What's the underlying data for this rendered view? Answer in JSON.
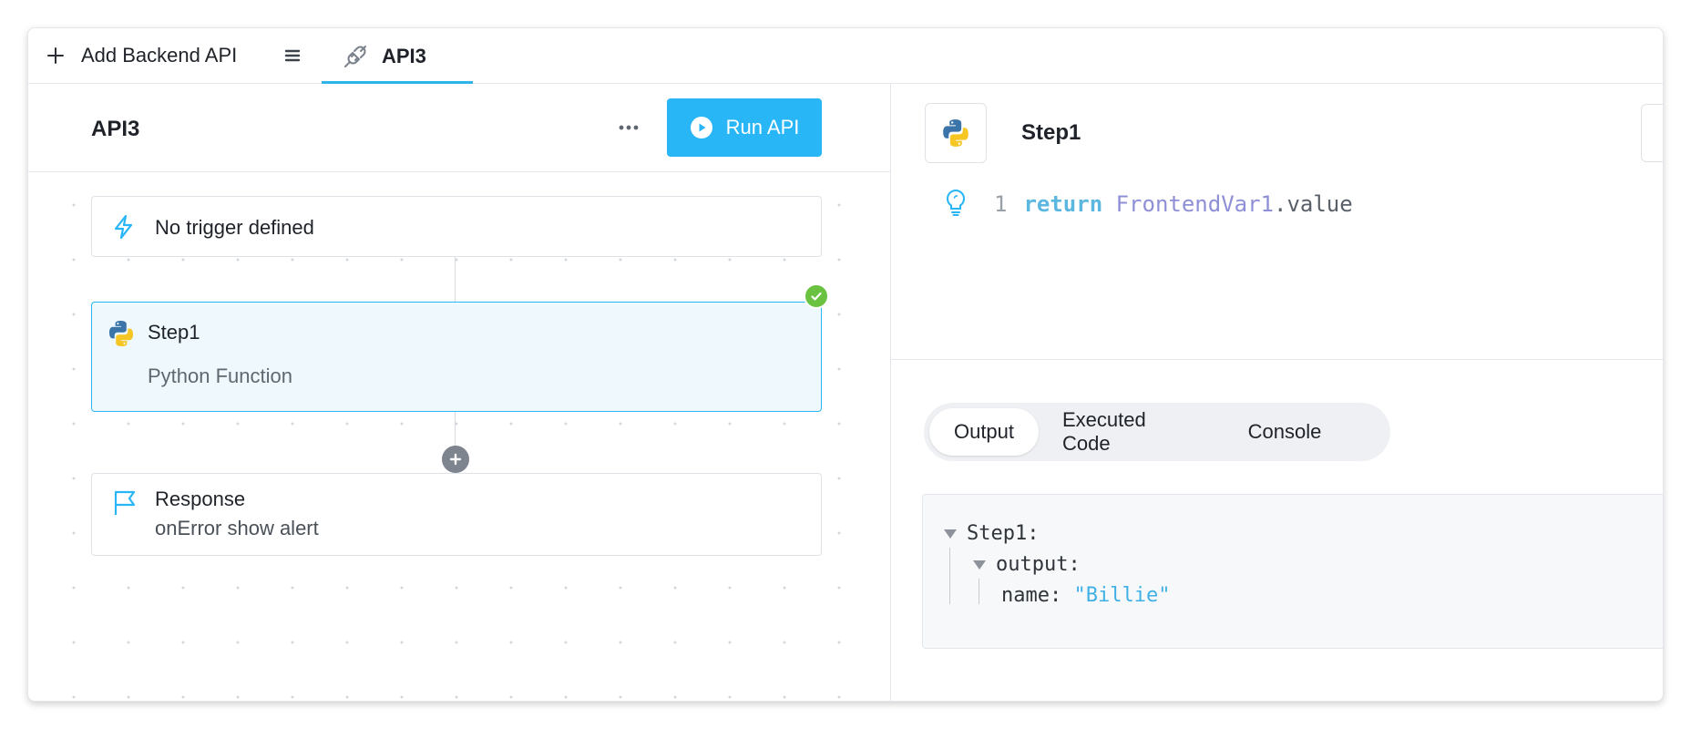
{
  "tabbar": {
    "add_label": "Add Backend API",
    "active_tab": "API3"
  },
  "left": {
    "api_title": "API3",
    "run_label": "Run API",
    "trigger_label": "No trigger defined",
    "step": {
      "title": "Step1",
      "subtitle": "Python Function"
    },
    "response": {
      "title": "Response",
      "subtitle": "onError show alert"
    }
  },
  "right": {
    "step_title": "Step1",
    "code": {
      "line_number": "1",
      "keyword": "return",
      "variable": "FrontendVar1",
      "property": ".value"
    },
    "tabs": [
      "Output",
      "Executed Code",
      "Console"
    ],
    "active_tab": "Output",
    "output": {
      "root_key": "Step1:",
      "child_key": "output:",
      "leaf_key": "name:",
      "leaf_value": "\"Billie\""
    }
  },
  "colors": {
    "accent": "#29b6f6",
    "success": "#6ac240",
    "string": "#3fb0e5",
    "keyword": "#5bb7e0",
    "variable": "#8e8fd6"
  },
  "icons": [
    "plus-icon",
    "menu-icon",
    "plug-icon",
    "more-icon",
    "play-icon",
    "lightning-icon",
    "python-icon",
    "check-icon",
    "add-step-icon",
    "flag-icon",
    "bulb-icon",
    "collapse-triangle-icon"
  ]
}
